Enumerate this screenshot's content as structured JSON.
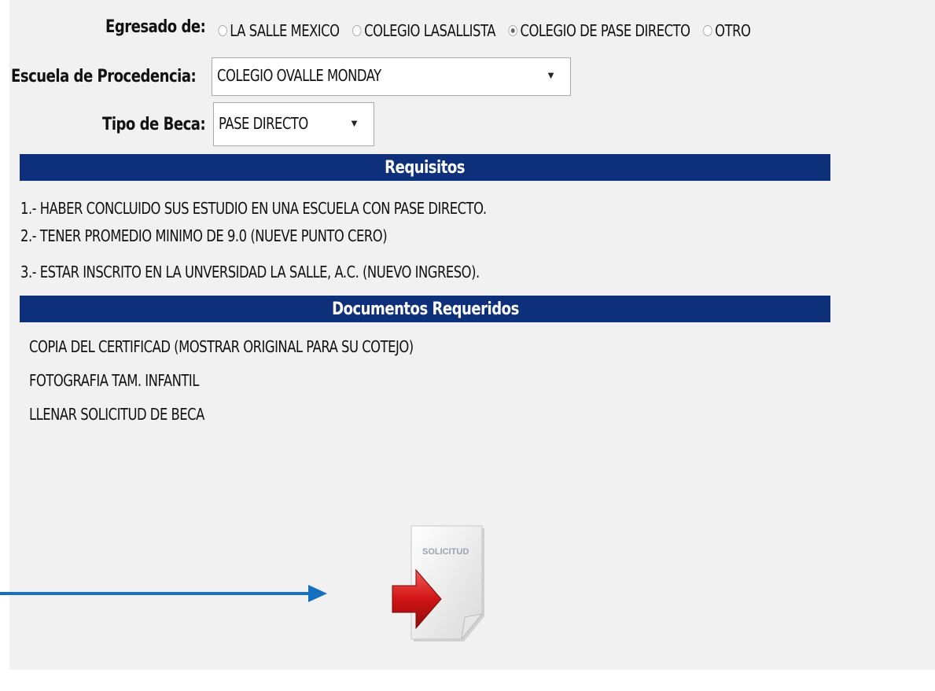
{
  "egresado": {
    "label": "Egresado de:",
    "options": [
      {
        "label": "LA SALLE MEXICO",
        "checked": false
      },
      {
        "label": "COLEGIO LASALLISTA",
        "checked": false
      },
      {
        "label": "COLEGIO DE PASE DIRECTO",
        "checked": true
      },
      {
        "label": "OTRO",
        "checked": false
      }
    ]
  },
  "escuela": {
    "label": "Escuela de Procedencia:",
    "value": "COLEGIO OVALLE MONDAY"
  },
  "tipo_beca": {
    "label": "Tipo de Beca:",
    "value": "PASE DIRECTO"
  },
  "requisitos": {
    "header": "Requisitos",
    "items": [
      "1.- HABER CONCLUIDO SUS ESTUDIO EN UNA ESCUELA CON PASE DIRECTO.",
      "2.- TENER PROMEDIO MINIMO DE 9.0 (NUEVE PUNTO CERO)",
      "3.- ESTAR INSCRITO EN LA UNVERSIDAD LA SALLE, A.C. (NUEVO INGRESO)."
    ]
  },
  "documentos": {
    "header": "Documentos Requeridos",
    "items": [
      "COPIA DEL CERTIFICAD (MOSTRAR ORIGINAL PARA SU COTEJO)",
      "FOTOGRAFIA TAM. INFANTIL",
      "LLENAR SOLICITUD DE BECA"
    ]
  },
  "solicitud_icon": {
    "icon": "solicitud-document-icon",
    "label": "SOLICITUD"
  },
  "colors": {
    "header_bar": "#0e2f7a",
    "annotation_arrow": "#1570c2",
    "panel_bg": "#f1f1f1"
  }
}
